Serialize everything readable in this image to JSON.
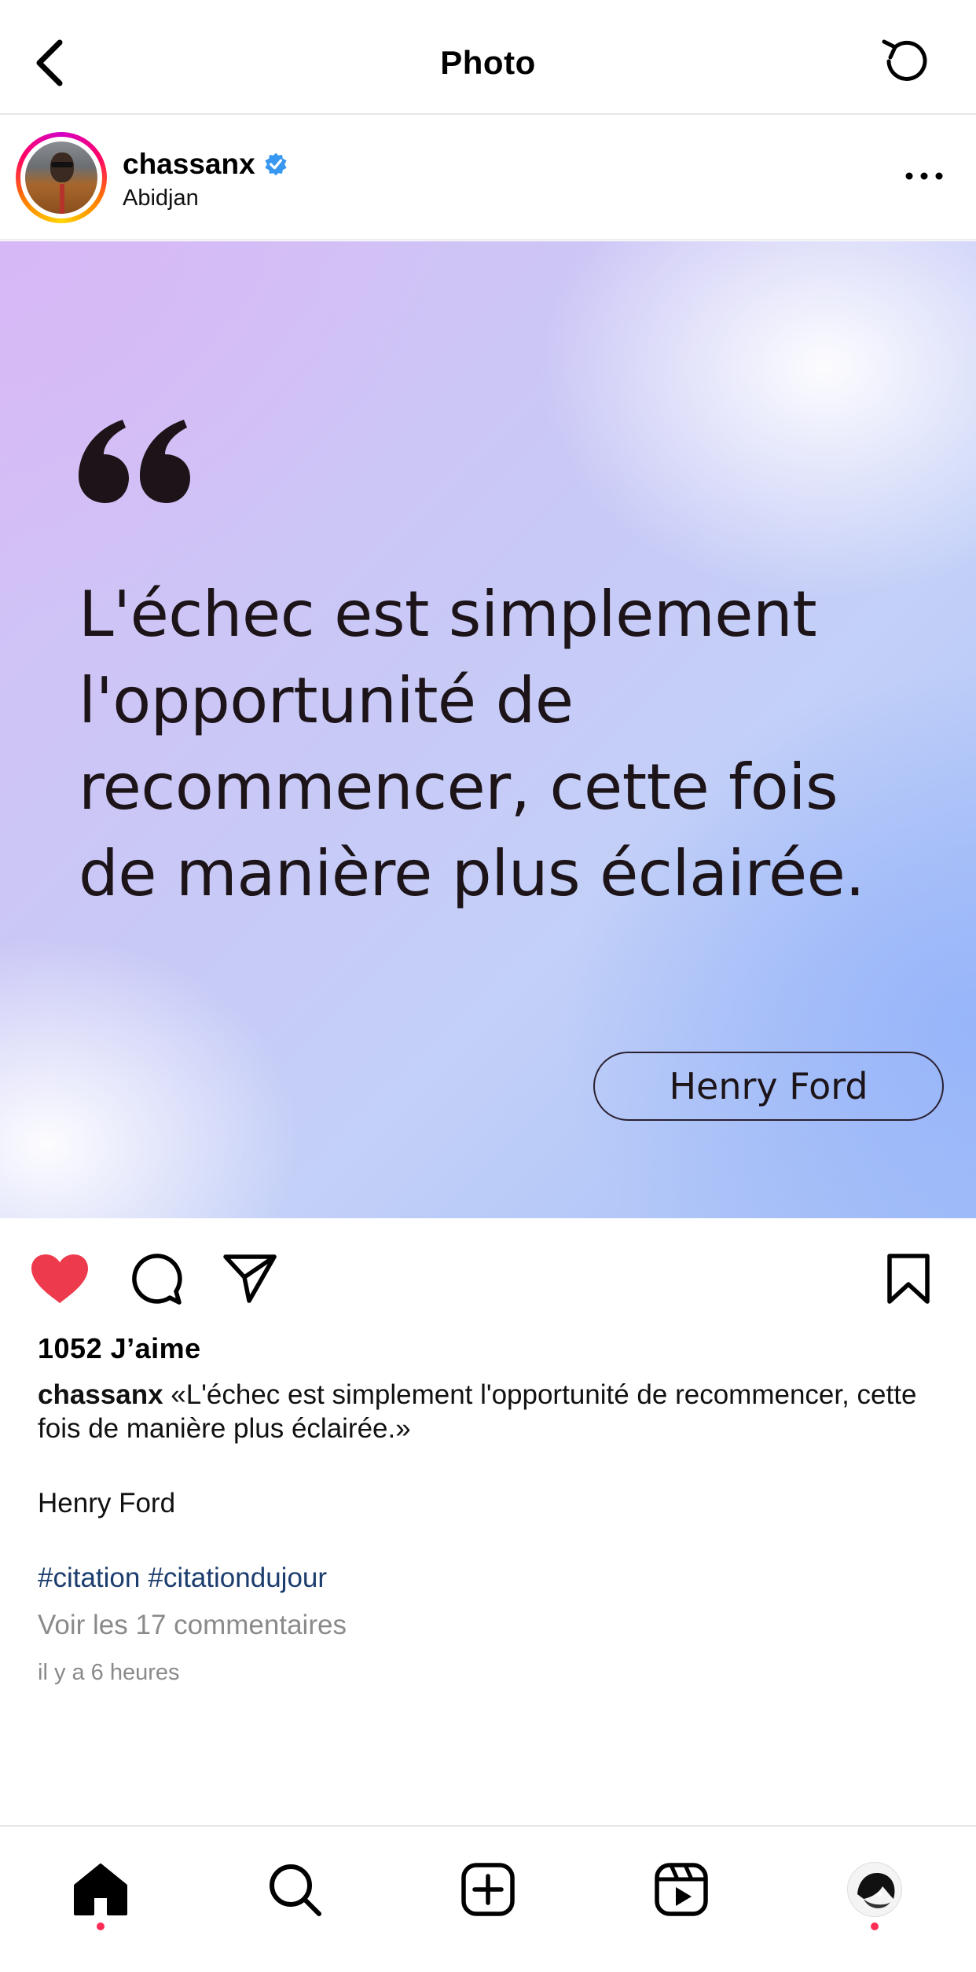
{
  "header": {
    "title": "Photo"
  },
  "post": {
    "username": "chassanx",
    "location": "Abidjan",
    "image": {
      "quote": "L'échec est simplement l'opportunité de recommencer, cette fois de manière plus éclairée.",
      "author": "Henry Ford",
      "colors": {
        "lilac": "#d8bdf5",
        "blue": "#a4bff7",
        "text": "#1c1418"
      }
    },
    "likes": "1052 J’aime",
    "caption_user": "chassanx",
    "caption_text": "«L'échec est simplement l'opportunité de recommencer, cette fois de manière plus éclairée.»",
    "caption_author": "Henry Ford",
    "hashtags": [
      "#citation",
      "#citationdujour"
    ],
    "comments_link": "Voir les 17 commentaires",
    "timestamp": "il y a 6 heures"
  },
  "icons": {
    "back": "chevron-left-icon",
    "refresh": "refresh-icon",
    "verified": "verified-badge-icon",
    "more": "more-horizontal-icon",
    "like": "heart-filled-icon",
    "comment": "comment-icon",
    "share": "send-icon",
    "save": "bookmark-icon",
    "nav": [
      "home-icon",
      "search-icon",
      "create-icon",
      "reels-icon",
      "profile-avatar"
    ]
  },
  "colors": {
    "like_red": "#ed3a4c",
    "hashtag_blue": "#1c3d6e",
    "muted_gray": "#8a8a8a",
    "notification_dot": "#ff2d55",
    "verified_blue": "#3897f0"
  }
}
